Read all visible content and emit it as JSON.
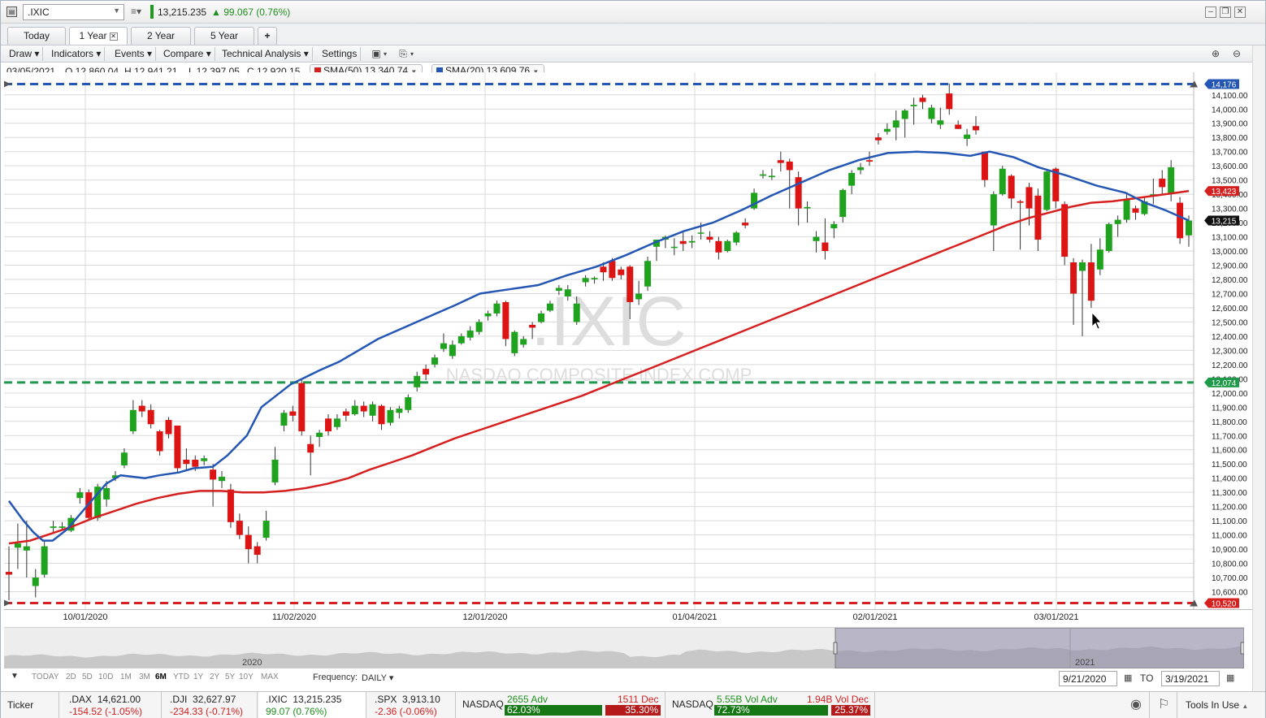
{
  "title": {
    "symbol": ".IXIC",
    "price": "13,215.235",
    "change": "99.067 (0.76%)",
    "change_color": "#1f9a1f"
  },
  "tabs": [
    {
      "label": "Today"
    },
    {
      "label": "1 Year",
      "active": true
    },
    {
      "label": "2 Year"
    },
    {
      "label": "5 Year"
    },
    {
      "label": "+"
    }
  ],
  "toolbar": {
    "draw": "Draw",
    "indicators": "Indicators",
    "events": "Events",
    "compare": "Compare",
    "technical": "Technical Analysis",
    "settings": "Settings"
  },
  "info": {
    "date": "03/05/2021",
    "open": "O 12,860.04",
    "high": "H 12,941.21",
    "low": "L 12,397.05",
    "close": "C 12,920.15",
    "sma50": "SMA(50) 13,340.74",
    "sma20": "SMA(20) 13,609.76",
    "sma50_color": "#d62020",
    "sma20_color": "#2456b4"
  },
  "chart_data": {
    "type": "candlestick",
    "watermark_symbol": ".IXIC",
    "watermark_name": "NASDAQ COMPOSITE INDEX COMP",
    "x_labels": [
      "10/01/2020",
      "11/02/2020",
      "12/01/2020",
      "01/04/2021",
      "02/01/2021",
      "03/01/2021"
    ],
    "y_ticks": [
      10600,
      10700,
      10800,
      10900,
      11000,
      11100,
      11200,
      11300,
      11400,
      11500,
      11600,
      11700,
      11800,
      11900,
      12000,
      12100,
      12200,
      12300,
      12400,
      12500,
      12600,
      12700,
      12800,
      12900,
      13000,
      13100,
      13200,
      13300,
      13400,
      13500,
      13600,
      13700,
      13800,
      13900,
      14000,
      14100
    ],
    "ylim": [
      10520,
      14176
    ],
    "levels": {
      "high": {
        "value": 14176,
        "label": "14,176",
        "color": "#2456b4"
      },
      "mid": {
        "value": 12074,
        "label": "12,074",
        "color": "#1e9a4a"
      },
      "low": {
        "value": 10520,
        "label": "10,520",
        "color": "#d62020"
      },
      "sma50_last": {
        "value": 13423,
        "label": "13,423",
        "color": "#d62020"
      },
      "last": {
        "value": 13215,
        "label": "13,215",
        "color": "#111111"
      }
    },
    "candles": [
      [
        10740,
        10720,
        10920,
        10540
      ],
      [
        10910,
        10940,
        11080,
        10760
      ],
      [
        10890,
        10920,
        11100,
        10700
      ],
      [
        10640,
        10700,
        10760,
        10560
      ],
      [
        10720,
        10920,
        10960,
        10700
      ],
      [
        11050,
        11060,
        11100,
        11020
      ],
      [
        11050,
        11060,
        11090,
        11030
      ],
      [
        11030,
        11120,
        11140,
        11020
      ],
      [
        11260,
        11300,
        11330,
        11220
      ],
      [
        11300,
        11120,
        11320,
        11100
      ],
      [
        11120,
        11340,
        11360,
        11100
      ],
      [
        11250,
        11330,
        11380,
        11200
      ],
      [
        11400,
        11420,
        11450,
        11380
      ],
      [
        11490,
        11580,
        11610,
        11470
      ],
      [
        11730,
        11880,
        11950,
        11710
      ],
      [
        11910,
        11870,
        11950,
        11830
      ],
      [
        11880,
        11780,
        11920,
        11750
      ],
      [
        11730,
        11590,
        11740,
        11560
      ],
      [
        11810,
        11710,
        11830,
        11680
      ],
      [
        11770,
        11470,
        11770,
        11440
      ],
      [
        11530,
        11500,
        11610,
        11460
      ],
      [
        11530,
        11480,
        11560,
        11450
      ],
      [
        11520,
        11540,
        11560,
        11490
      ],
      [
        11460,
        11390,
        11500,
        11200
      ],
      [
        11380,
        11410,
        11450,
        11330
      ],
      [
        11320,
        11090,
        11360,
        11050
      ],
      [
        11100,
        11000,
        11150,
        10970
      ],
      [
        11000,
        10900,
        11060,
        10800
      ],
      [
        10920,
        10860,
        10950,
        10800
      ],
      [
        10980,
        11100,
        11170,
        10960
      ],
      [
        11370,
        11530,
        11620,
        11350
      ],
      [
        11770,
        11860,
        11880,
        11730
      ],
      [
        11870,
        11840,
        11910,
        11800
      ],
      [
        12070,
        11730,
        12100,
        11700
      ],
      [
        11640,
        11580,
        11700,
        11420
      ],
      [
        11690,
        11720,
        11740,
        11620
      ],
      [
        11820,
        11730,
        11850,
        11700
      ],
      [
        11760,
        11820,
        11850,
        11740
      ],
      [
        11870,
        11840,
        11890,
        11800
      ],
      [
        11850,
        11910,
        11950,
        11840
      ],
      [
        11910,
        11870,
        11940,
        11830
      ],
      [
        11840,
        11920,
        11940,
        11800
      ],
      [
        11910,
        11780,
        11920,
        11740
      ],
      [
        11790,
        11880,
        11900,
        11770
      ],
      [
        11860,
        11890,
        11910,
        11820
      ],
      [
        11880,
        11970,
        11990,
        11860
      ],
      [
        12040,
        12120,
        12150,
        12010
      ],
      [
        12170,
        12130,
        12200,
        12090
      ],
      [
        12200,
        12250,
        12270,
        12180
      ],
      [
        12310,
        12350,
        12420,
        12290
      ],
      [
        12260,
        12340,
        12370,
        12240
      ],
      [
        12350,
        12400,
        12420,
        12340
      ],
      [
        12390,
        12440,
        12470,
        12370
      ],
      [
        12430,
        12500,
        12520,
        12410
      ],
      [
        12540,
        12560,
        12580,
        12510
      ],
      [
        12560,
        12630,
        12650,
        12540
      ],
      [
        12640,
        12380,
        12650,
        12330
      ],
      [
        12280,
        12430,
        12440,
        12260
      ],
      [
        12340,
        12380,
        12400,
        12320
      ],
      [
        12480,
        12460,
        12500,
        12380
      ],
      [
        12500,
        12560,
        12580,
        12490
      ],
      [
        12580,
        12630,
        12650,
        12570
      ],
      [
        12720,
        12740,
        12760,
        12690
      ],
      [
        12680,
        12730,
        12760,
        12650
      ],
      [
        12500,
        12630,
        12680,
        12480
      ],
      [
        12780,
        12810,
        12830,
        12750
      ],
      [
        12800,
        12810,
        12820,
        12770
      ],
      [
        12890,
        12850,
        12920,
        12790
      ],
      [
        12930,
        12810,
        12950,
        12790
      ],
      [
        12870,
        12830,
        12890,
        12800
      ],
      [
        12890,
        12640,
        12900,
        12520
      ],
      [
        12660,
        12700,
        12790,
        12620
      ],
      [
        12750,
        12930,
        12960,
        12720
      ],
      [
        13030,
        13080,
        13080,
        12930
      ],
      [
        13080,
        13100,
        13110,
        13020
      ],
      [
        13030,
        13030,
        13090,
        12970
      ],
      [
        13070,
        13050,
        13130,
        13000
      ],
      [
        13060,
        13070,
        13110,
        13020
      ],
      [
        13130,
        13130,
        13200,
        13080
      ],
      [
        13100,
        13080,
        13140,
        13060
      ],
      [
        13070,
        12990,
        13100,
        12940
      ],
      [
        13000,
        13070,
        13080,
        12990
      ],
      [
        13060,
        13130,
        13140,
        13040
      ],
      [
        13200,
        13180,
        13230,
        13160
      ],
      [
        13300,
        13410,
        13440,
        13290
      ],
      [
        13530,
        13540,
        13570,
        13510
      ],
      [
        13520,
        13530,
        13580,
        13500
      ],
      [
        13640,
        13620,
        13700,
        13560
      ],
      [
        13630,
        13570,
        13650,
        13300
      ],
      [
        13520,
        13300,
        13560,
        13180
      ],
      [
        13300,
        13310,
        13350,
        13200
      ],
      [
        13070,
        13100,
        13140,
        12990
      ],
      [
        13060,
        13000,
        13230,
        12940
      ],
      [
        13160,
        13190,
        13210,
        13090
      ],
      [
        13240,
        13430,
        13440,
        13200
      ],
      [
        13460,
        13550,
        13570,
        13400
      ],
      [
        13570,
        13590,
        13620,
        13540
      ],
      [
        13640,
        13630,
        13700,
        13600
      ],
      [
        13800,
        13780,
        13830,
        13750
      ],
      [
        13840,
        13860,
        13900,
        13820
      ],
      [
        13870,
        13920,
        13990,
        13780
      ],
      [
        13930,
        13990,
        14000,
        13800
      ],
      [
        14020,
        14030,
        14080,
        13890
      ],
      [
        14080,
        14050,
        14100,
        14000
      ],
      [
        13930,
        14010,
        14030,
        13900
      ],
      [
        13890,
        13920,
        14010,
        13860
      ],
      [
        14110,
        14000,
        14180,
        13960
      ],
      [
        13890,
        13860,
        13920,
        13860
      ],
      [
        13790,
        13820,
        13860,
        13740
      ],
      [
        13880,
        13850,
        13950,
        13820
      ],
      [
        13700,
        13500,
        13700,
        13450
      ],
      [
        13180,
        13400,
        13420,
        13000
      ],
      [
        13400,
        13580,
        13600,
        13390
      ],
      [
        13530,
        13370,
        13540,
        13300
      ],
      [
        13350,
        13340,
        13360,
        13010
      ],
      [
        13450,
        13300,
        13480,
        13180
      ],
      [
        13390,
        13080,
        13440,
        13000
      ],
      [
        13290,
        13560,
        13570,
        13280
      ],
      [
        13580,
        13350,
        13590,
        13300
      ],
      [
        13330,
        12960,
        13350,
        12900
      ],
      [
        12920,
        12700,
        12950,
        12480
      ],
      [
        12860,
        12920,
        12940,
        12400
      ],
      [
        12920,
        12650,
        13050,
        12600
      ],
      [
        12870,
        13010,
        13090,
        12830
      ],
      [
        13000,
        13190,
        13200,
        12990
      ],
      [
        13190,
        13220,
        13250,
        13100
      ],
      [
        13220,
        13360,
        13410,
        13200
      ],
      [
        13300,
        13270,
        13320,
        13220
      ],
      [
        13260,
        13350,
        13380,
        13250
      ],
      [
        13400,
        13400,
        13510,
        13330
      ],
      [
        13510,
        13450,
        13570,
        13400
      ],
      [
        13410,
        13590,
        13640,
        13350
      ],
      [
        13340,
        13090,
        13380,
        13050
      ],
      [
        13110,
        13215,
        13250,
        13030
      ]
    ],
    "sma20": [
      [
        0,
        11240
      ],
      [
        6,
        11100
      ],
      [
        10,
        11020
      ],
      [
        14,
        10960
      ],
      [
        18,
        10960
      ],
      [
        24,
        11040
      ],
      [
        32,
        11200
      ],
      [
        40,
        11360
      ],
      [
        46,
        11420
      ],
      [
        56,
        11400
      ],
      [
        62,
        11420
      ],
      [
        70,
        11440
      ],
      [
        76,
        11470
      ],
      [
        84,
        11480
      ],
      [
        90,
        11560
      ],
      [
        98,
        11700
      ],
      [
        104,
        11900
      ],
      [
        110,
        11980
      ],
      [
        116,
        12060
      ],
      [
        122,
        12110
      ],
      [
        128,
        12160
      ],
      [
        136,
        12220
      ],
      [
        144,
        12300
      ],
      [
        152,
        12380
      ],
      [
        160,
        12440
      ],
      [
        168,
        12500
      ],
      [
        176,
        12560
      ],
      [
        184,
        12620
      ],
      [
        194,
        12700
      ],
      [
        206,
        12730
      ],
      [
        218,
        12760
      ],
      [
        230,
        12830
      ],
      [
        242,
        12890
      ],
      [
        254,
        12970
      ],
      [
        266,
        13060
      ],
      [
        278,
        13140
      ],
      [
        290,
        13200
      ],
      [
        302,
        13290
      ],
      [
        314,
        13390
      ],
      [
        326,
        13480
      ],
      [
        338,
        13570
      ],
      [
        350,
        13640
      ],
      [
        362,
        13690
      ],
      [
        374,
        13700
      ],
      [
        386,
        13690
      ],
      [
        396,
        13670
      ],
      [
        404,
        13700
      ],
      [
        414,
        13660
      ],
      [
        424,
        13590
      ],
      [
        436,
        13530
      ],
      [
        448,
        13460
      ],
      [
        460,
        13410
      ],
      [
        468,
        13340
      ],
      [
        476,
        13290
      ],
      [
        486,
        13215
      ]
    ],
    "sma50": [
      [
        0,
        10940
      ],
      [
        10,
        10960
      ],
      [
        20,
        11010
      ],
      [
        30,
        11060
      ],
      [
        40,
        11120
      ],
      [
        50,
        11170
      ],
      [
        60,
        11220
      ],
      [
        70,
        11260
      ],
      [
        80,
        11290
      ],
      [
        90,
        11310
      ],
      [
        100,
        11310
      ],
      [
        110,
        11300
      ],
      [
        120,
        11300
      ],
      [
        130,
        11310
      ],
      [
        140,
        11330
      ],
      [
        150,
        11360
      ],
      [
        160,
        11400
      ],
      [
        170,
        11460
      ],
      [
        180,
        11510
      ],
      [
        190,
        11560
      ],
      [
        200,
        11620
      ],
      [
        210,
        11680
      ],
      [
        220,
        11730
      ],
      [
        230,
        11780
      ],
      [
        240,
        11830
      ],
      [
        250,
        11880
      ],
      [
        260,
        11930
      ],
      [
        270,
        11980
      ],
      [
        280,
        12040
      ],
      [
        290,
        12100
      ],
      [
        300,
        12160
      ],
      [
        310,
        12220
      ],
      [
        320,
        12280
      ],
      [
        330,
        12340
      ],
      [
        340,
        12400
      ],
      [
        350,
        12460
      ],
      [
        360,
        12520
      ],
      [
        370,
        12580
      ],
      [
        380,
        12640
      ],
      [
        390,
        12700
      ],
      [
        400,
        12760
      ],
      [
        410,
        12820
      ],
      [
        420,
        12880
      ],
      [
        430,
        12940
      ],
      [
        440,
        13000
      ],
      [
        450,
        13060
      ],
      [
        460,
        13120
      ],
      [
        470,
        13180
      ],
      [
        480,
        13230
      ],
      [
        490,
        13270
      ],
      [
        500,
        13310
      ],
      [
        510,
        13340
      ],
      [
        520,
        13350
      ],
      [
        530,
        13370
      ],
      [
        540,
        13390
      ],
      [
        550,
        13410
      ],
      [
        556,
        13423
      ]
    ]
  },
  "navigator": {
    "year1": "2020",
    "year2": "2021"
  },
  "rangebar": {
    "ranges": [
      "TODAY",
      "2D",
      "5D",
      "10D",
      "1M",
      "3M",
      "6M",
      "YTD",
      "1Y",
      "2Y",
      "5Y",
      "10Y",
      "MAX"
    ],
    "active_range": "6M",
    "frequency_label": "Frequency:",
    "frequency_value": "DAILY",
    "from": "9/21/2020",
    "to_label": "TO",
    "to": "3/19/2021"
  },
  "tickers": {
    "label": "Ticker",
    "items": [
      {
        "sym": ".DAX",
        "price": "14,621.00",
        "chg": "-154.52 (-1.05%)",
        "dir": "neg"
      },
      {
        "sym": ".DJI",
        "price": "32,627.97",
        "chg": "-234.33 (-0.71%)",
        "dir": "neg"
      },
      {
        "sym": ".IXIC",
        "price": "13,215.235",
        "chg": "99.07 (0.76%)",
        "dir": "pos"
      },
      {
        "sym": ".SPX",
        "price": "3,913.10",
        "chg": "-2.36 (-0.06%)",
        "dir": "neg"
      }
    ],
    "breadth1": {
      "name": "NASDAQ",
      "adv": "2655 Adv",
      "dec": "1511 Dec",
      "adv_pct": "62.03%",
      "dec_pct": "35.30%"
    },
    "breadth2": {
      "name": "NASDAQ",
      "adv": "5.55B Vol Adv",
      "dec": "1.94B Vol Dec",
      "adv_pct": "72.73%",
      "dec_pct": "25.37%"
    },
    "tools": "Tools In Use"
  }
}
